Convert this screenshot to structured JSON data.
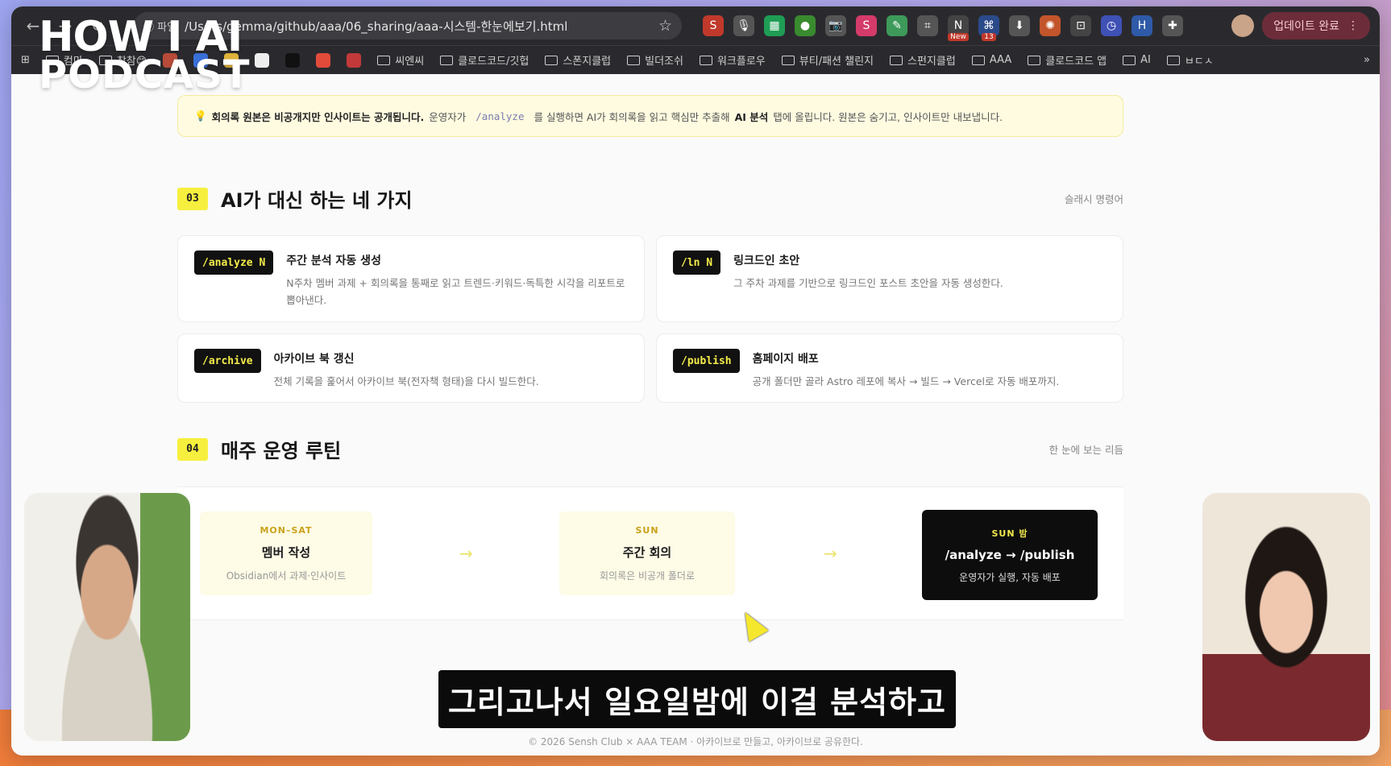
{
  "browser": {
    "file_chip": "파일",
    "url": "/Users/gemma/github/aaa/06_sharing/aaa-시스템-한눈에보기.html",
    "update_label": "업데이트 완료",
    "extensions": [
      {
        "name": "red-s-ext",
        "color": "#c0392b",
        "glyph": "S"
      },
      {
        "name": "mic-ext",
        "color": "#555555",
        "glyph": "🎙"
      },
      {
        "name": "green-sheet-ext",
        "color": "#1f9d55",
        "glyph": "▦"
      },
      {
        "name": "green-circle-ext",
        "color": "#3a8a2f",
        "glyph": "●"
      },
      {
        "name": "camera-ext",
        "color": "#555555",
        "glyph": "📷"
      },
      {
        "name": "s-ext",
        "color": "#d43b6a",
        "glyph": "S"
      },
      {
        "name": "leaf-ext",
        "color": "#3d9a5a",
        "glyph": "✎"
      },
      {
        "name": "bracket-ext",
        "color": "#555555",
        "glyph": "⌗"
      },
      {
        "name": "new-ext",
        "color": "#444444",
        "glyph": "N",
        "badge": "New"
      },
      {
        "name": "tab-ext",
        "color": "#2b4a8a",
        "glyph": "⌘",
        "badge": "13"
      },
      {
        "name": "download-ext",
        "color": "#555555",
        "glyph": "⬇"
      },
      {
        "name": "sun-ext",
        "color": "#c2552b",
        "glyph": "✺"
      },
      {
        "name": "scan-ext",
        "color": "#444444",
        "glyph": "⊡"
      },
      {
        "name": "clock-ext",
        "color": "#3f51b5",
        "glyph": "◷"
      },
      {
        "name": "h-ext",
        "color": "#2e5aa8",
        "glyph": "H"
      },
      {
        "name": "puzzle-ext",
        "color": "#555555",
        "glyph": "✚"
      }
    ]
  },
  "bookmarks": [
    {
      "type": "folder",
      "label": "컴마"
    },
    {
      "type": "folder",
      "label": "참참😊"
    },
    {
      "type": "icon",
      "color": "#b84b3a",
      "label": ""
    },
    {
      "type": "icon",
      "color": "#3a6fd8",
      "label": ""
    },
    {
      "type": "icon",
      "color": "#e0b43a",
      "label": ""
    },
    {
      "type": "icon",
      "color": "#eeeeee",
      "label": ""
    },
    {
      "type": "icon",
      "color": "#111111",
      "label": ""
    },
    {
      "type": "icon",
      "color": "#e24b3a",
      "label": ""
    },
    {
      "type": "icon",
      "color": "#c3393a",
      "label": ""
    },
    {
      "type": "folder",
      "label": "씨엔씨"
    },
    {
      "type": "folder",
      "label": "클로드코드/깃헙"
    },
    {
      "type": "folder",
      "label": "스폰지클럽"
    },
    {
      "type": "folder",
      "label": "빌더조쉬"
    },
    {
      "type": "folder",
      "label": "워크플로우"
    },
    {
      "type": "folder",
      "label": "뷰티/패션 챌린지"
    },
    {
      "type": "folder",
      "label": "스펀지클럽"
    },
    {
      "type": "folder",
      "label": "AAA"
    },
    {
      "type": "folder",
      "label": "클로드코드 앱"
    },
    {
      "type": "folder",
      "label": "AI"
    },
    {
      "type": "folder",
      "label": "ㅂㄷㅅ"
    }
  ],
  "notice": {
    "emphasis": "회의록 원본은 비공개지만 인사이트는 공개됩니다.",
    "pre": "운영자가",
    "code": "/analyze",
    "post": "를 실행하면 AI가 회의록을 읽고 핵심만 추출해",
    "strong": "AI 분석",
    "tail": "탭에 올립니다. 원본은 숨기고, 인사이트만 내보냅니다."
  },
  "section3": {
    "num": "03",
    "title": "AI가 대신 하는 네 가지",
    "side": "슬래시 명령어",
    "cards": [
      {
        "cmd": "/analyze N",
        "title": "주간 분석 자동 생성",
        "desc": "N주차 멤버 과제 + 회의록을 통째로 읽고 트렌드·키워드·독특한 시각을 리포트로 뽑아낸다."
      },
      {
        "cmd": "/ln N",
        "title": "링크드인 초안",
        "desc": "그 주차 과제를 기반으로 링크드인 포스트 초안을 자동 생성한다."
      },
      {
        "cmd": "/archive",
        "title": "아카이브 북 갱신",
        "desc": "전체 기록을 훑어서 아카이브 북(전자책 형태)을 다시 빌드한다."
      },
      {
        "cmd": "/publish",
        "title": "홈페이지 배포",
        "desc": "공개 폴더만 골라 Astro 레포에 복사 → 빌드 → Vercel로 자동 배포까지."
      }
    ]
  },
  "section4": {
    "num": "04",
    "title": "매주 운영 루틴",
    "side": "한 눈에 보는 리듬",
    "steps": [
      {
        "tag": "MON–SAT",
        "title": "멤버 작성",
        "sub": "Obsidian에서 과제·인사이트"
      },
      {
        "tag": "SUN",
        "title": "주간 회의",
        "sub": "회의록은 비공개 폴더로"
      },
      {
        "tag": "SUN 밤",
        "title": "/analyze → /publish",
        "sub": "운영자가 실행, 자동 배포"
      }
    ],
    "arrow": "→"
  },
  "footer": "© 2026 Sensh Club × AAA TEAM · 아카이브로 만들고, 아카이브로 공유한다.",
  "overlay": {
    "logo_line1": "HOW I AI",
    "logo_line2": "PODCAST",
    "subtitle": "그리고나서 일요일밤에 이걸 분석하고"
  }
}
